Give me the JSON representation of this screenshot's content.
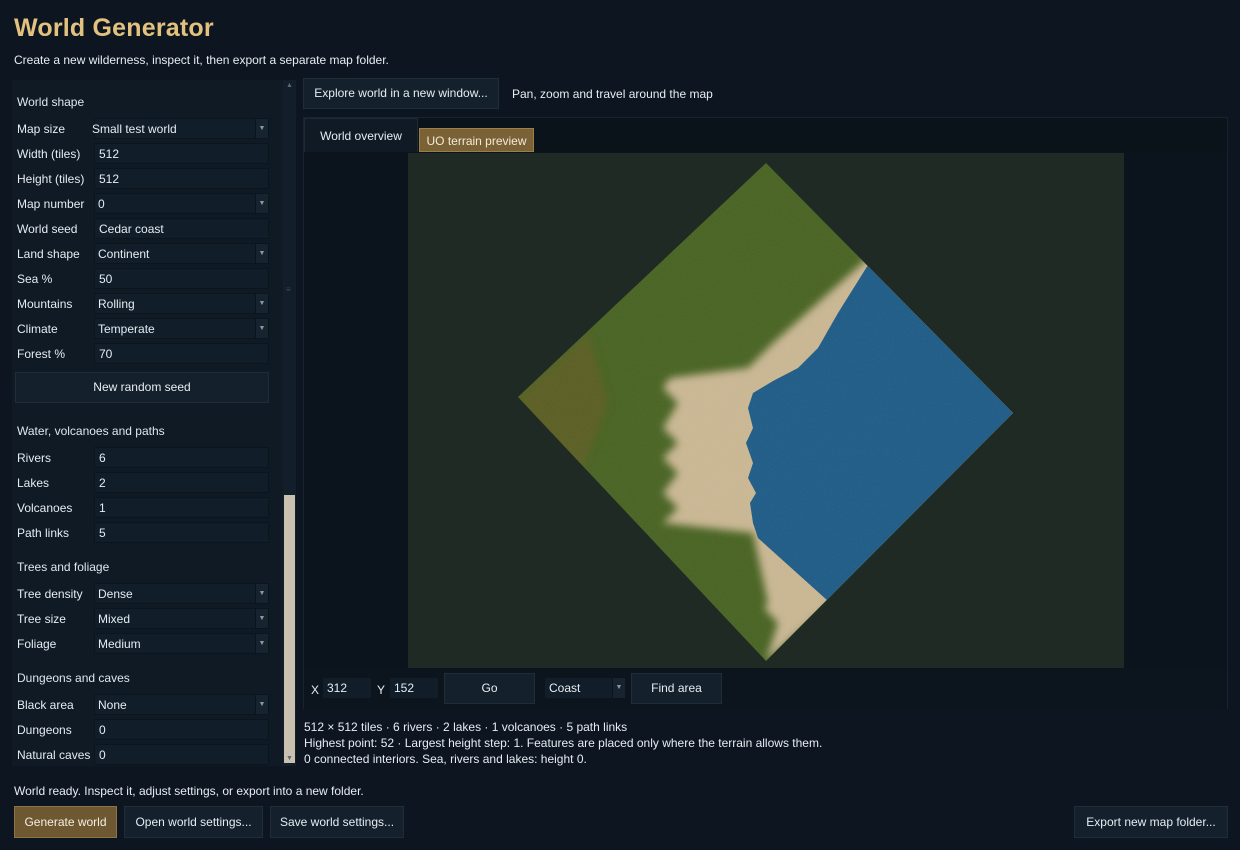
{
  "app": {
    "title": "World Generator",
    "subtitle": "Create a new wilderness, inspect it, then export a separate map folder."
  },
  "colors": {
    "accent": "#e2c27e",
    "primary_button": "#6e5832",
    "background": "#0d1620",
    "grass": "#4a6a26",
    "sand": "#d4c09a",
    "water": "#1f5c8a"
  },
  "left_panel": {
    "world_shape": {
      "heading": "World shape",
      "map_size": {
        "label": "Map size",
        "value": "Small test world"
      },
      "width": {
        "label": "Width (tiles)",
        "value": "512"
      },
      "height": {
        "label": "Height (tiles)",
        "value": "512"
      },
      "map_number": {
        "label": "Map number",
        "value": "0"
      },
      "world_seed": {
        "label": "World seed",
        "value": "Cedar coast"
      },
      "land_shape": {
        "label": "Land shape",
        "value": "Continent"
      },
      "sea": {
        "label": "Sea %",
        "value": "50"
      },
      "mountains": {
        "label": "Mountains",
        "value": "Rolling"
      },
      "climate": {
        "label": "Climate",
        "value": "Temperate"
      },
      "forest": {
        "label": "Forest %",
        "value": "70"
      },
      "random_seed_button": "New random seed"
    },
    "water": {
      "heading": "Water, volcanoes and paths",
      "rivers": {
        "label": "Rivers",
        "value": "6"
      },
      "lakes": {
        "label": "Lakes",
        "value": "2"
      },
      "volcanoes": {
        "label": "Volcanoes",
        "value": "1"
      },
      "path_links": {
        "label": "Path links",
        "value": "5"
      }
    },
    "trees": {
      "heading": "Trees and foliage",
      "density": {
        "label": "Tree density",
        "value": "Dense"
      },
      "size": {
        "label": "Tree size",
        "value": "Mixed"
      },
      "foliage": {
        "label": "Foliage",
        "value": "Medium"
      }
    },
    "dungeons": {
      "heading": "Dungeons and caves",
      "black_area": {
        "label": "Black area",
        "value": "None"
      },
      "dungeons": {
        "label": "Dungeons",
        "value": "0"
      },
      "natural_caves": {
        "label": "Natural caves",
        "value": "0"
      }
    }
  },
  "right": {
    "explore_button": "Explore world in a new window...",
    "explore_hint": "Pan, zoom and travel around the map",
    "tabs": [
      {
        "label": "World overview",
        "selected": false
      },
      {
        "label": "UO terrain preview",
        "selected": true
      }
    ],
    "coords": {
      "x_label": "X",
      "x_value": "312",
      "y_label": "Y",
      "y_value": "152",
      "go_button": "Go",
      "area_value": "Coast",
      "find_button": "Find area"
    },
    "stats": [
      "512 × 512 tiles · 6 rivers · 2 lakes · 1 volcanoes · 5 path links",
      "Highest point: 52 · Largest height step: 1. Features are placed only where the terrain allows them.",
      "0 connected interiors. Sea, rivers and lakes: height 0."
    ]
  },
  "footer": {
    "status": "World ready. Inspect it, adjust settings, or export into a new folder.",
    "generate_button": "Generate world",
    "open_button": "Open world settings...",
    "save_button": "Save world settings...",
    "export_button": "Export new map folder..."
  }
}
